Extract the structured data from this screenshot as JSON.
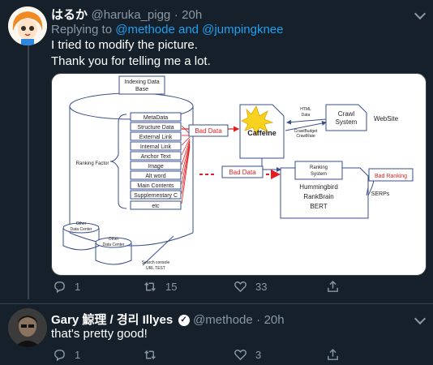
{
  "tweet1": {
    "name": "はるか",
    "handle": "@haruka_pigg",
    "dot": "·",
    "time": "20h",
    "replying_prefix": "Replying to",
    "replying_users": "@methode and @jumpingknee",
    "line1": "I tried to modify the picture.",
    "line2": "Thank you for telling me a lot.",
    "counts": {
      "replies": "1",
      "retweets": "15",
      "likes": "33"
    }
  },
  "diagram": {
    "indexing_db": "Indexing Data\nBase",
    "metadata": "MetaData",
    "structure_data": "Structure Data",
    "external_link": "External Link",
    "internal_link": "Internal Link",
    "anchor_text": "Anchor Text",
    "image": "Image",
    "alt_word": "Alt word",
    "main_contents": "Main Contents",
    "supplementary": "Supplementary C",
    "etc": "etc",
    "ranking_factor": "Ranking Factor",
    "bad_data_1": "Bad Data",
    "bad_data_2": "Bad Data",
    "caffeine": "Caffeine",
    "html_data_1": "HTML",
    "html_data_2": "Data",
    "crawl_budget": "CrawlBudget",
    "crawl_rate": "CrawlRate",
    "crawl_system_1": "Crawl",
    "crawl_system_2": "System",
    "website": "WebSite",
    "ranking_system_1": "Ranking",
    "ranking_system_2": "System",
    "hummingbird": "Hummingbird",
    "rankbrain": "RankBrain",
    "bert": "BERT",
    "bad_ranking": "Bad Ranking",
    "serps": "SERPs",
    "other_dc_1": "Other\nData Center",
    "other_dc_2": "Other\nData Center",
    "search_console_1": "Search console",
    "search_console_2": "URL TEST"
  },
  "tweet2": {
    "name": "Gary 鯨理 / 경리 Illyes",
    "handle": "@methode",
    "dot": "·",
    "time": "20h",
    "text": "that's pretty good!",
    "counts": {
      "replies": "1",
      "likes": "3"
    }
  },
  "colors": {
    "background": "#15202b",
    "link": "#1da1f2",
    "muted": "#8899a6",
    "bad": "#e02020",
    "diagram_line": "#3a4f8a"
  },
  "icons": [
    "avatar-anime",
    "reply-icon",
    "retweet-icon",
    "like-icon",
    "share-icon",
    "chevron-down-icon",
    "verified-icon",
    "avatar-photo"
  ]
}
